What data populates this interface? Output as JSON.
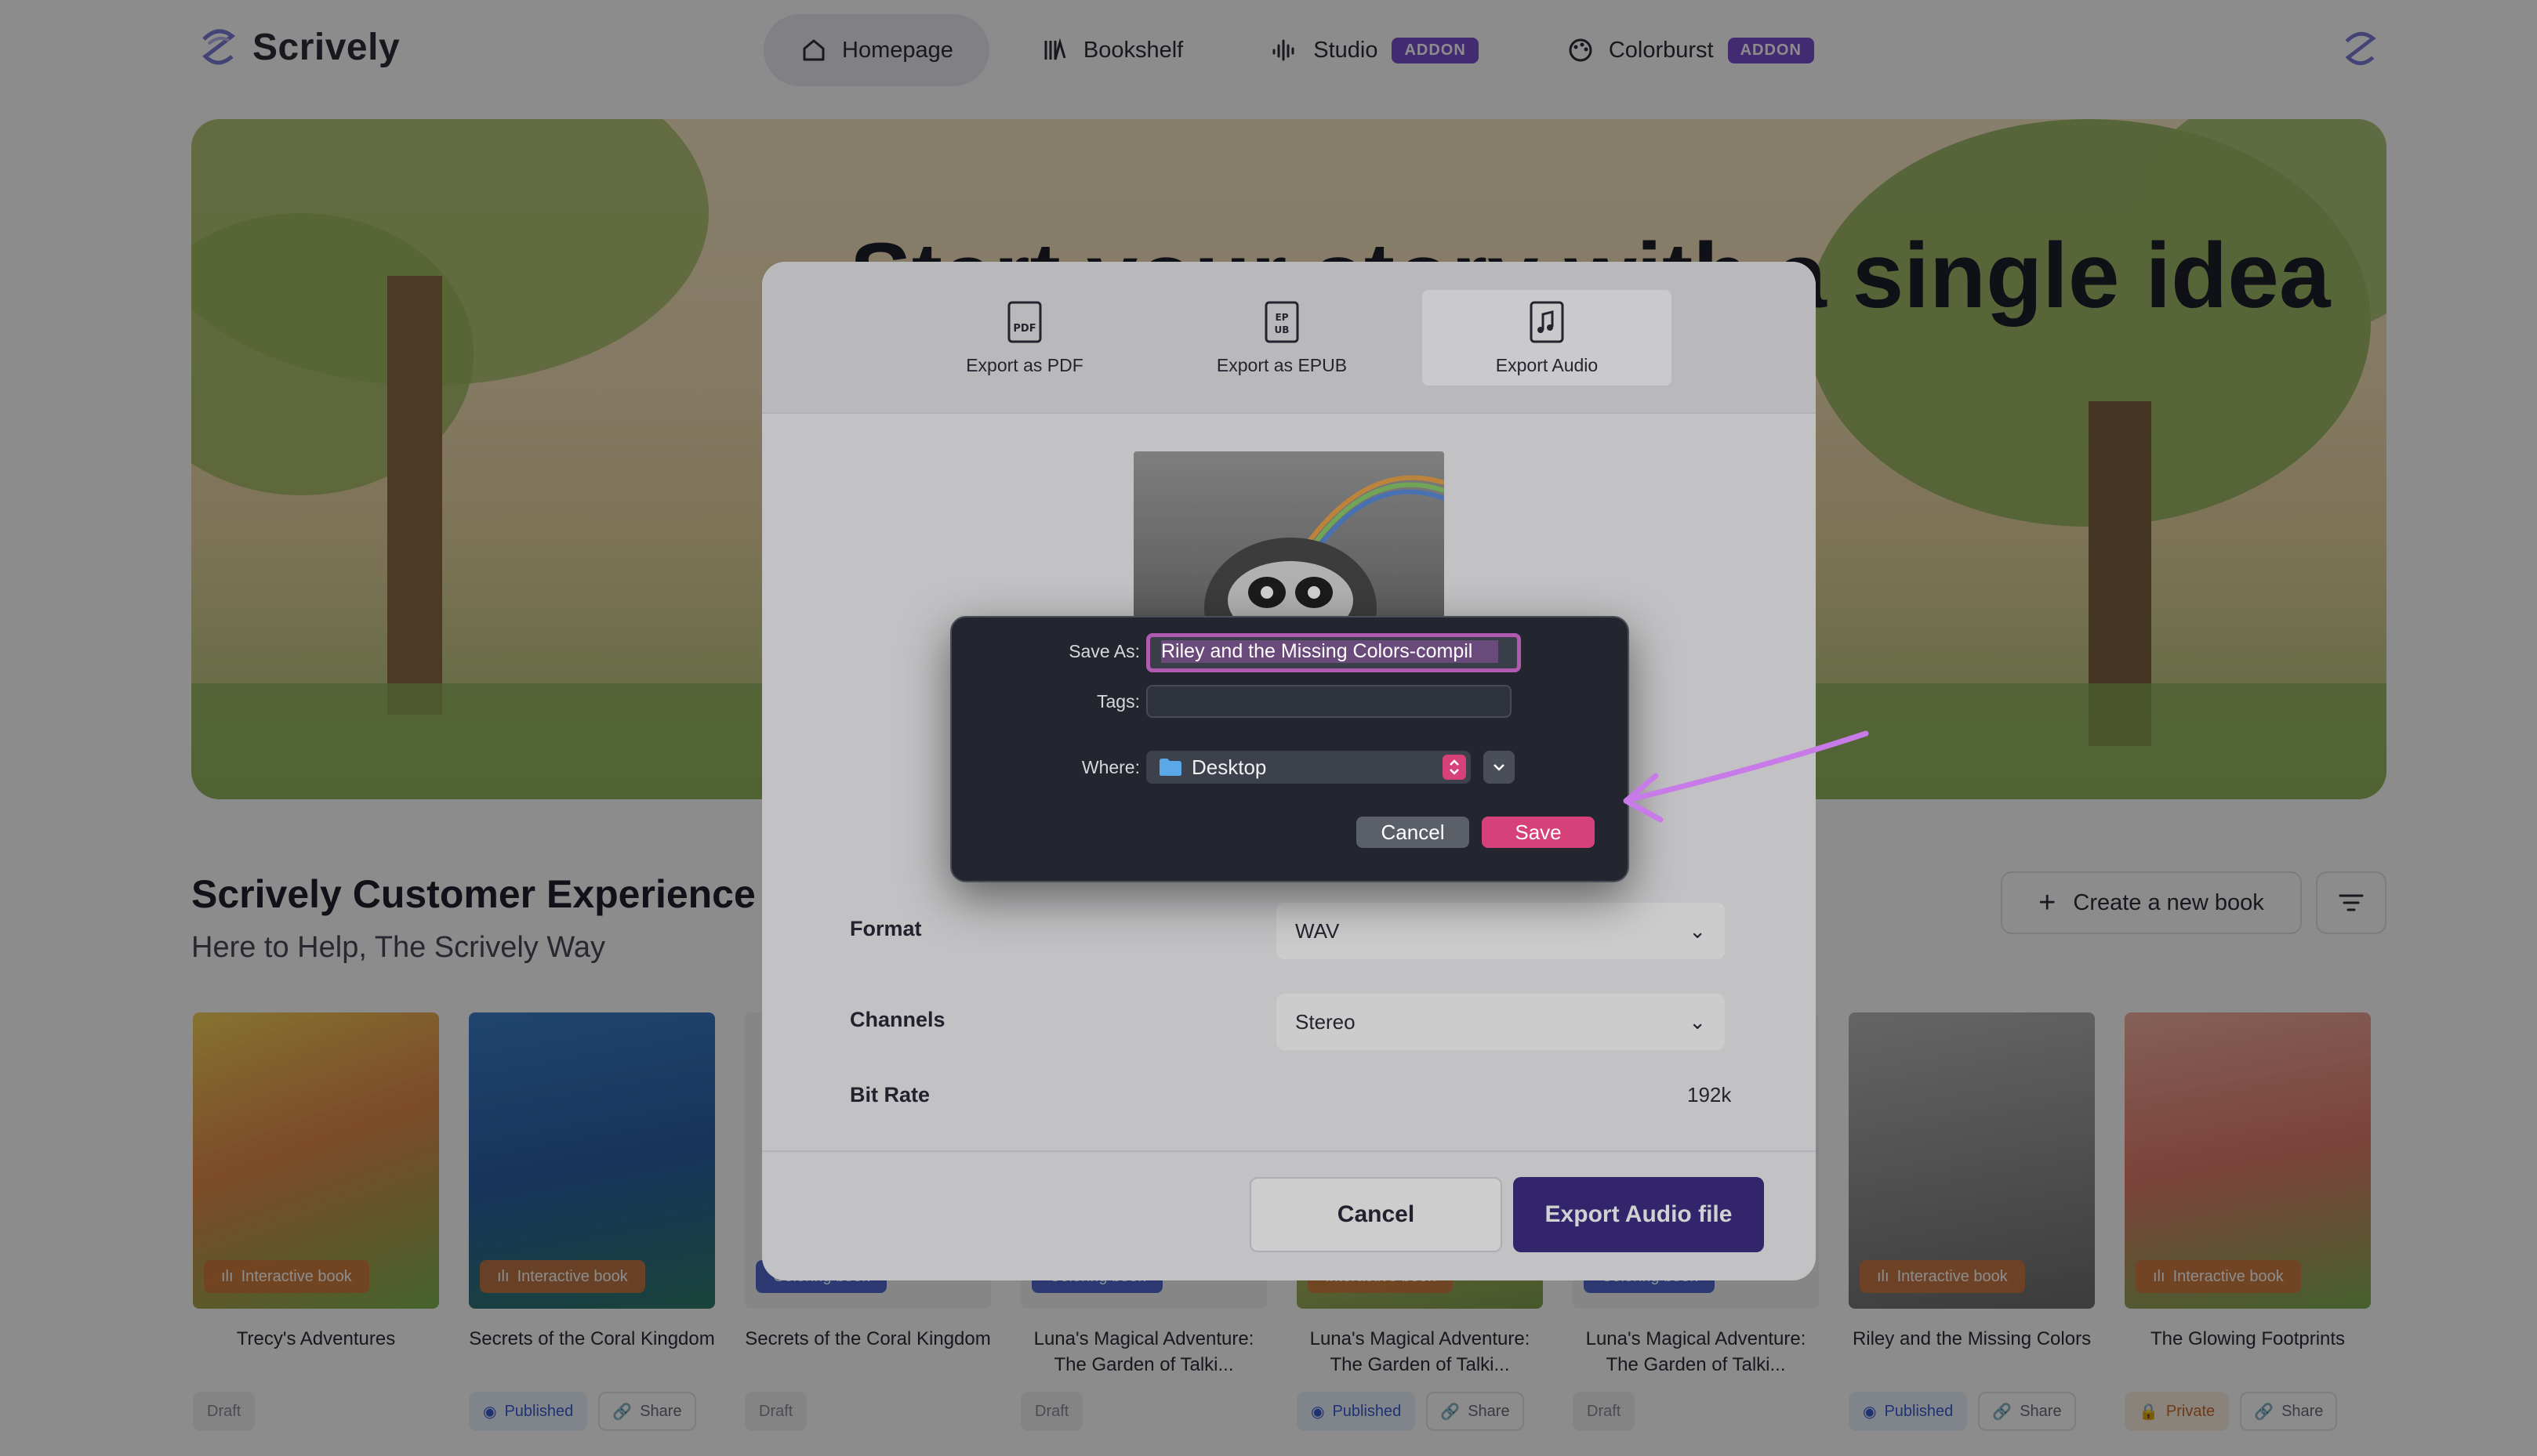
{
  "app": {
    "name": "Scrively"
  },
  "nav": {
    "items": [
      {
        "label": "Homepage",
        "icon": "home-icon"
      },
      {
        "label": "Bookshelf",
        "icon": "bookshelf-icon"
      },
      {
        "label": "Studio",
        "icon": "waveform-icon",
        "badge": "ADDON"
      },
      {
        "label": "Colorburst",
        "icon": "palette-icon",
        "badge": "ADDON"
      }
    ]
  },
  "hero": {
    "title": "Start your story with a single idea"
  },
  "section": {
    "title": "Scrively Customer Experience Te",
    "subtitle": "Here to Help, The Scrively Way",
    "create_label": "Create a new book"
  },
  "books": [
    {
      "title": "Trecy's Adventures",
      "badge": "Interactive book",
      "status": "Draft",
      "share": ""
    },
    {
      "title": "Secrets of the Coral Kingdom",
      "badge": "Interactive book",
      "status": "Published",
      "share": "Share"
    },
    {
      "title": "Secrets of the Coral Kingdom",
      "badge": "Coloring book",
      "status": "Draft",
      "share": ""
    },
    {
      "title": "Luna's Magical Adventure: The Garden of Talki...",
      "badge": "Coloring book",
      "status": "Draft",
      "share": ""
    },
    {
      "title": "Luna's Magical Adventure: The Garden of Talki...",
      "badge": "Interactive book",
      "status": "Published",
      "share": "Share"
    },
    {
      "title": "Luna's Magical Adventure: The Garden of Talki...",
      "badge": "Coloring book",
      "status": "Draft",
      "share": ""
    },
    {
      "title": "Riley and the Missing Colors",
      "badge": "Interactive book",
      "status": "Published",
      "share": "Share"
    },
    {
      "title": "The Glowing Footprints",
      "badge": "Interactive book",
      "status": "Private",
      "share": "Share"
    }
  ],
  "export_modal": {
    "tabs": [
      {
        "label": "Export as PDF",
        "icon": "pdf-file-icon"
      },
      {
        "label": "Export as EPUB",
        "icon": "epub-file-icon"
      },
      {
        "label": "Export Audio",
        "icon": "audio-file-icon"
      }
    ],
    "format_label": "Format",
    "format_value": "WAV",
    "channels_label": "Channels",
    "channels_value": "Stereo",
    "bitrate_label": "Bit Rate",
    "bitrate_value": "192k",
    "cancel_label": "Cancel",
    "export_label": "Export Audio file"
  },
  "save_dialog": {
    "save_as_label": "Save As:",
    "save_as_value": "Riley and the Missing Colors-compil",
    "tags_label": "Tags:",
    "tags_value": "",
    "where_label": "Where:",
    "where_value": "Desktop",
    "cancel_label": "Cancel",
    "save_label": "Save"
  },
  "colors": {
    "accent": "#3e2e84",
    "save_pink": "#d6417a",
    "annotation_arrow": "#c87be8",
    "badge_purple": "#7a4fd0"
  }
}
